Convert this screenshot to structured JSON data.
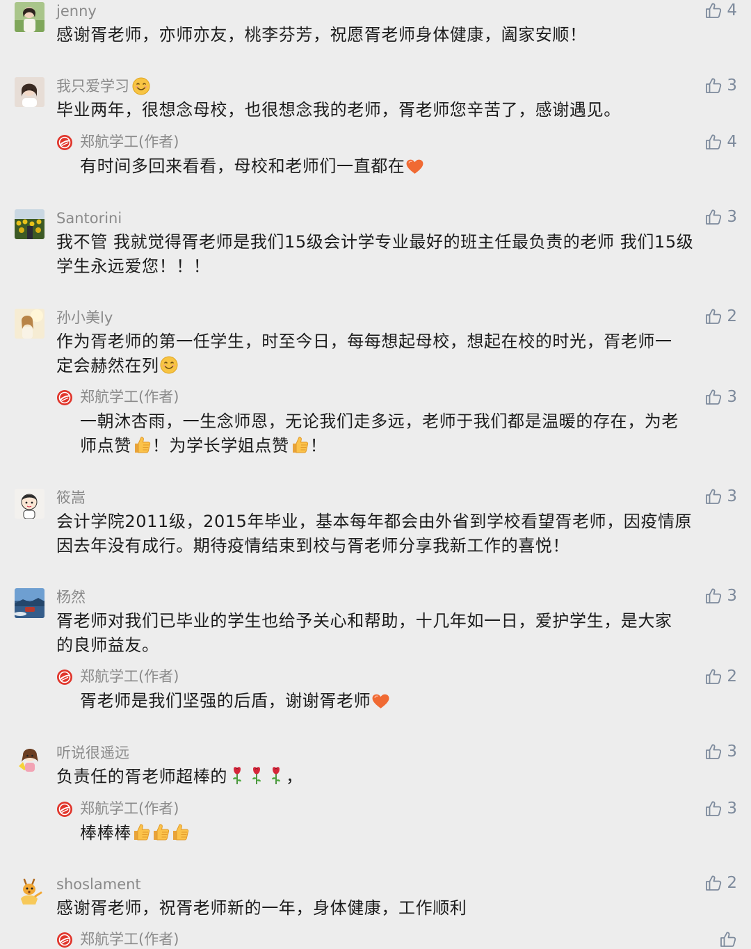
{
  "comments": [
    {
      "name": "jenny",
      "text": "感谢胥老师，亦师亦友，桃李芬芳，祝愿胥老师身体健康，阖家安顺！",
      "likes": "4",
      "avatar_icon": "portrait-avatar"
    },
    {
      "name": "我只爱学习",
      "name_emoji": "smile-emoji",
      "text": "毕业两年，很想念母校，也很想念我的老师，胥老师您辛苦了，感谢遇见。",
      "likes": "3",
      "avatar_icon": "portrait-avatar",
      "reply": {
        "name": "郑航学工(作者)",
        "text": "有时间多回来看看，母校和老师们一直都在",
        "text_emoji": "heart-emoji",
        "likes": "4"
      }
    },
    {
      "name": "Santorini",
      "text_line1": "我不管 我就觉得胥老师是我们15级会计学专业最好的班主任最负责的老师 我们15级",
      "text_line2": "学生永远爱您！！！",
      "likes": "3",
      "avatar_icon": "sunflower-avatar"
    },
    {
      "name": "孙小美ly",
      "text_line1": "作为胥老师的第一任学生，时至今日，每每想起母校，想起在校的时光，胥老师一",
      "text_line2": "定会赫然在列",
      "text_emoji": "smile-emoji",
      "likes": "2",
      "avatar_icon": "portrait-avatar",
      "reply": {
        "name": "郑航学工(作者)",
        "text_line1": "一朝沐杏雨，一生念师恩，无论我们走多远，老师于我们都是温暖的存在，为老",
        "text_line2a": "师点赞",
        "text_line2b": "！为学长学姐点赞",
        "text_line2c": "！",
        "likes": "3"
      }
    },
    {
      "name": "筱嵩",
      "text_line1": "会计学院2011级，2015年毕业，基本每年都会由外省到学校看望胥老师，因疫情原",
      "text_line2": "因去年没有成行。期待疫情结束到校与胥老师分享我新工作的喜悦！",
      "likes": "3",
      "avatar_icon": "cartoon-avatar"
    },
    {
      "name": "杨然",
      "text_line1": "胥老师对我们已毕业的学生也给予关心和帮助，十几年如一日，爱护学生，是大家",
      "text_line2": "的良师益友。",
      "likes": "3",
      "avatar_icon": "landscape-avatar",
      "reply": {
        "name": "郑航学工(作者)",
        "text": "胥老师是我们坚强的后盾，谢谢胥老师",
        "text_emoji": "heart-emoji",
        "likes": "2"
      }
    },
    {
      "name": "听说很遥远",
      "text": "负责任的胥老师超棒的",
      "text_tail": "，",
      "likes": "3",
      "avatar_icon": "cartoon-girl-avatar",
      "reply": {
        "name": "郑航学工(作者)",
        "text": "棒棒棒",
        "likes": "3"
      }
    },
    {
      "name": "shoslament",
      "text": "感谢胥老师，祝胥老师新的一年，身体健康，工作顺利",
      "likes": "2",
      "avatar_icon": "deer-avatar",
      "reply": {
        "name": "郑航学工(作者)"
      }
    }
  ],
  "colors": {
    "background": "#ededed",
    "name": "#8a8a8a",
    "text": "#1c1c1c",
    "like": "#7d8a9c",
    "author_logo": "#e0352b"
  }
}
